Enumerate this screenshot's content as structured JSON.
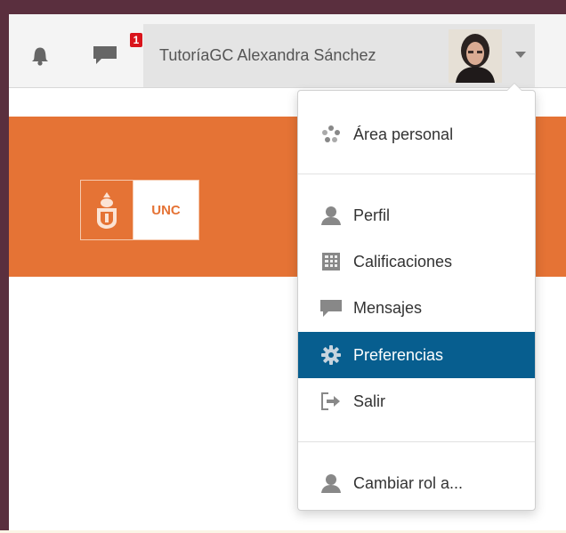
{
  "navbar": {
    "notifications_icon": "bell-icon",
    "messages_icon": "speech-bubble-icon",
    "messages_badge": "1",
    "user_name": "TutoríaGC Alexandra Sánchez",
    "dropdown_caret_icon": "caret-down-icon"
  },
  "banner": {
    "color": "#e57335",
    "logo_text": "UNC"
  },
  "user_menu": {
    "items": [
      {
        "label": "Área personal",
        "icon": "dashboard-icon"
      },
      {
        "label": "Perfil",
        "icon": "user-icon"
      },
      {
        "label": "Calificaciones",
        "icon": "grades-table-icon"
      },
      {
        "label": "Mensajes",
        "icon": "message-icon"
      },
      {
        "label": "Preferencias",
        "icon": "gear-icon",
        "active": true
      },
      {
        "label": "Salir",
        "icon": "logout-icon"
      },
      {
        "label": "Cambiar rol a...",
        "icon": "user-icon"
      }
    ],
    "active_color": "#075e8f"
  }
}
